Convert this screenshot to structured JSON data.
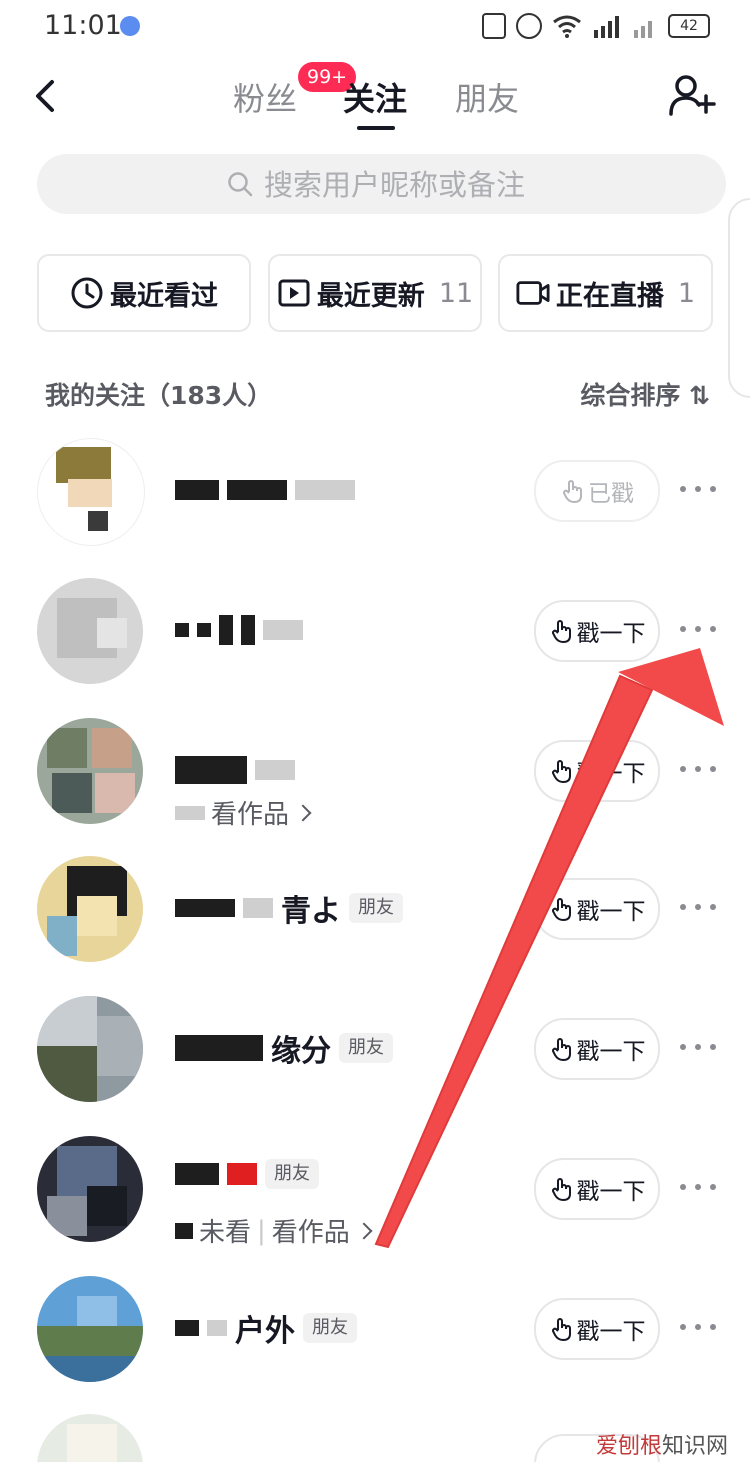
{
  "status_bar": {
    "time": "11:01",
    "battery": "42"
  },
  "header": {
    "tabs": [
      {
        "label": "粉丝",
        "active": false
      },
      {
        "label": "关注",
        "active": true
      },
      {
        "label": "朋友",
        "active": false
      }
    ],
    "badge": "99+"
  },
  "search": {
    "placeholder": "搜索用户昵称或备注"
  },
  "filters": [
    {
      "label": "最近看过",
      "icon": "clock-icon",
      "count": ""
    },
    {
      "label": "最近更新",
      "icon": "play-square-icon",
      "count": "11"
    },
    {
      "label": "正在直播",
      "icon": "video-camera-icon",
      "count": "1"
    }
  ],
  "list": {
    "title": "我的关注（183人）",
    "sort_label": "综合排序"
  },
  "rows": [
    {
      "name": "",
      "tag": "",
      "sub": "",
      "action": "已戳",
      "action_done": true
    },
    {
      "name": "",
      "tag": "",
      "sub": "",
      "action": "戳一下",
      "action_done": false
    },
    {
      "name": "",
      "tag": "",
      "sub": "看作品",
      "action": "戳一下",
      "action_done": false
    },
    {
      "name": "青よ",
      "tag": "朋友",
      "sub": "",
      "action": "戳一下",
      "action_done": false
    },
    {
      "name": "缘分",
      "tag": "朋友",
      "sub": "",
      "action": "戳一下",
      "action_done": false
    },
    {
      "name": "",
      "tag": "朋友",
      "sub_prefix": "未看",
      "sub": "看作品",
      "action": "戳一下",
      "action_done": false
    },
    {
      "name": "户外",
      "tag": "朋友",
      "sub": "",
      "action": "戳一下",
      "action_done": false
    }
  ],
  "watermark": {
    "red": "爱刨根",
    "grey": "知识网"
  },
  "colors": {
    "accent": "#fe2c55",
    "arrow": "#f24a4a",
    "text": "#161823",
    "muted": "#8a8b91"
  }
}
